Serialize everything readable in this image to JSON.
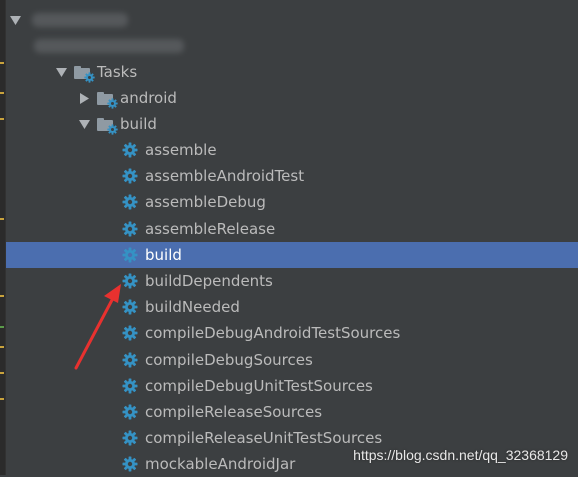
{
  "tree": {
    "group": {
      "label": "Tasks"
    },
    "folders": [
      {
        "label": "android",
        "expanded": false
      },
      {
        "label": "build",
        "expanded": true
      }
    ],
    "tasks": [
      {
        "label": "assemble"
      },
      {
        "label": "assembleAndroidTest"
      },
      {
        "label": "assembleDebug"
      },
      {
        "label": "assembleRelease"
      },
      {
        "label": "build",
        "selected": true
      },
      {
        "label": "buildDependents"
      },
      {
        "label": "buildNeeded"
      },
      {
        "label": "compileDebugAndroidTestSources"
      },
      {
        "label": "compileDebugSources"
      },
      {
        "label": "compileDebugUnitTestSources"
      },
      {
        "label": "compileReleaseSources"
      },
      {
        "label": "compileReleaseUnitTestSources"
      },
      {
        "label": "mockableAndroidJar"
      }
    ]
  },
  "watermark": "https://blog.csdn.net/qq_32368129",
  "colors": {
    "background": "#3c3f41",
    "selection": "#4b6eaf",
    "gear": "#3592c4",
    "annotation_arrow": "#e8312f"
  },
  "icons": {
    "expand": "triangle-down-icon",
    "collapse": "triangle-right-icon",
    "task": "gear-icon",
    "folder": "folder-gear-icon"
  }
}
